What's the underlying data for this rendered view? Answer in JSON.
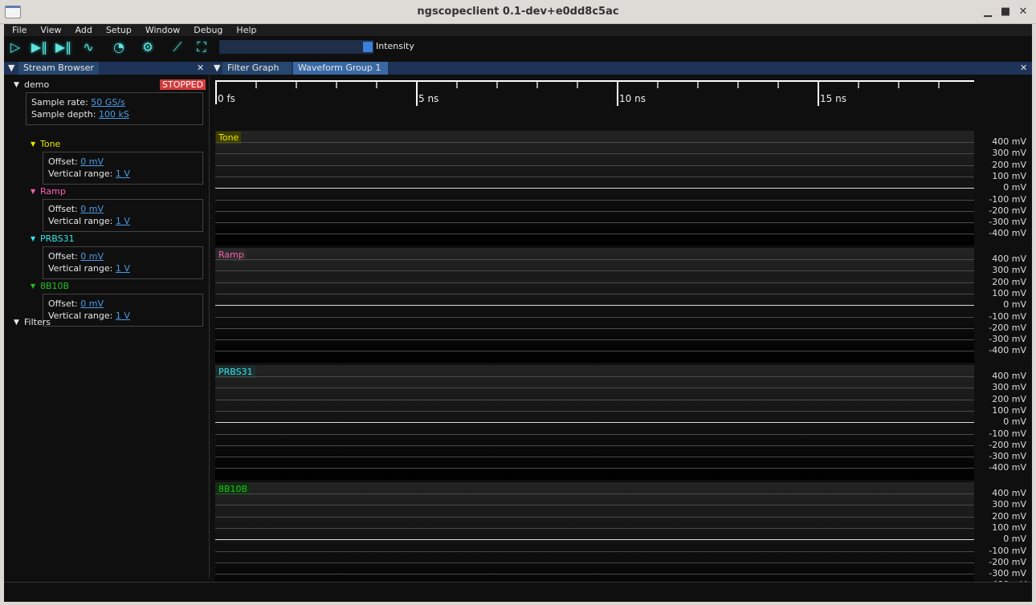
{
  "window": {
    "title": "ngscopeclient 0.1-dev+e0dd8c5ac"
  },
  "menu": [
    "File",
    "View",
    "Add",
    "Setup",
    "Window",
    "Debug",
    "Help"
  ],
  "toolbar": {
    "icons": [
      "trigger-arm-icon",
      "trigger-single-icon",
      "trigger-force-icon",
      "waveform-icon",
      "history-icon",
      "settings-gear-icon",
      "measure-icon",
      "fullscreen-icon"
    ],
    "intensity_label": "Intensity",
    "intensity": 1.0
  },
  "left_panel": {
    "tab": "Stream Browser",
    "instrument": {
      "name": "demo",
      "status": "STOPPED",
      "sample_rate_label": "Sample rate:",
      "sample_rate": "50 GS/s",
      "sample_depth_label": "Sample depth:",
      "sample_depth": "100 kS"
    },
    "offset_label": "Offset:",
    "range_label": "Vertical range:",
    "filters_label": "Filters"
  },
  "right_panel": {
    "tabs": [
      "Filter Graph",
      "Waveform Group 1"
    ]
  },
  "timeline": {
    "labels": [
      "0 fs",
      "5 ns",
      "10 ns",
      "15 ns"
    ]
  },
  "y_axis_labels": [
    "400 mV",
    "300 mV",
    "200 mV",
    "100 mV",
    "0 mV",
    "-100 mV",
    "-200 mV",
    "-300 mV",
    "-400 mV"
  ],
  "channels": [
    {
      "name": "Tone",
      "color": "#e6e600",
      "label_bg": "#3d3d00",
      "offset": "0 mV",
      "range": "1 V"
    },
    {
      "name": "Ramp",
      "color": "#ff5fb4",
      "label_bg": "#2a2a2a",
      "offset": "0 mV",
      "range": "1 V"
    },
    {
      "name": "PRBS31",
      "color": "#33e6e6",
      "label_bg": "#1e2e2e",
      "offset": "0 mV",
      "range": "1 V"
    },
    {
      "name": "8B10B",
      "color": "#22c022",
      "label_bg": "#0f300f",
      "offset": "0 mV",
      "range": "1 V"
    }
  ]
}
